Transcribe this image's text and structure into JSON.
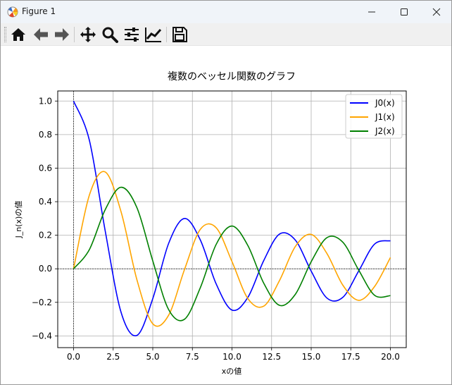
{
  "window": {
    "title": "Figure 1",
    "controls": {
      "minimize": "minimize",
      "maximize": "maximize",
      "close": "close"
    }
  },
  "toolbar": {
    "buttons": [
      {
        "name": "home",
        "icon": "home-icon",
        "tooltip": ""
      },
      {
        "name": "back",
        "icon": "arrow-left-icon",
        "tooltip": ""
      },
      {
        "name": "forward",
        "icon": "arrow-right-icon",
        "tooltip": ""
      },
      {
        "name": "pan",
        "icon": "move-icon",
        "tooltip": ""
      },
      {
        "name": "zoom",
        "icon": "magnifier-icon",
        "tooltip": ""
      },
      {
        "name": "configure-subplots",
        "icon": "sliders-icon",
        "tooltip": ""
      },
      {
        "name": "edit-axis",
        "icon": "line-chart-icon",
        "tooltip": ""
      },
      {
        "name": "save",
        "icon": "floppy-disk-icon",
        "tooltip": ""
      }
    ]
  },
  "colors": {
    "J0": "#0000ff",
    "J1": "#ffa500",
    "J2": "#008000",
    "grid": "#b0b0b0",
    "axis": "#000000"
  },
  "chart_data": {
    "type": "line",
    "title": "複数のベッセル関数のグラフ",
    "xlabel": "xの値",
    "ylabel": "J_n(x)の値",
    "xlim": [
      -1.0,
      21.0
    ],
    "ylim": [
      -0.47,
      1.06
    ],
    "xticks": [
      0.0,
      2.5,
      5.0,
      7.5,
      10.0,
      12.5,
      15.0,
      17.5,
      20.0
    ],
    "xtick_labels": [
      "0.0",
      "2.5",
      "5.0",
      "7.5",
      "10.0",
      "12.5",
      "15.0",
      "17.5",
      "20.0"
    ],
    "yticks": [
      -0.4,
      -0.2,
      0.0,
      0.2,
      0.4,
      0.6,
      0.8,
      1.0
    ],
    "ytick_labels": [
      "−0.4",
      "−0.2",
      "0.0",
      "0.2",
      "0.4",
      "0.6",
      "0.8",
      "1.0"
    ],
    "grid": true,
    "reference_lines": {
      "x": 0,
      "y": 0,
      "style": "dashed"
    },
    "legend": {
      "placement": "top-right",
      "entries": [
        "J0(x)",
        "J1(x)",
        "J2(x)"
      ]
    },
    "x": [
      0,
      1,
      2,
      3,
      4,
      5,
      6,
      7,
      8,
      9,
      10,
      11,
      12,
      13,
      14,
      15,
      16,
      17,
      18,
      19,
      20
    ],
    "series": [
      {
        "name": "J0(x)",
        "color": "#0000ff",
        "orders": 0,
        "values": [
          1.0,
          0.765,
          0.224,
          -0.26,
          -0.397,
          -0.178,
          0.151,
          0.3,
          0.172,
          -0.09,
          -0.246,
          -0.171,
          0.048,
          0.207,
          0.171,
          -0.014,
          -0.175,
          -0.17,
          -0.013,
          0.147,
          0.167
        ]
      },
      {
        "name": "J1(x)",
        "color": "#ffa500",
        "orders": 1,
        "values": [
          0.0,
          0.44,
          0.577,
          0.339,
          -0.066,
          -0.328,
          -0.277,
          -0.005,
          0.235,
          0.245,
          0.043,
          -0.177,
          -0.223,
          -0.07,
          0.133,
          0.205,
          0.09,
          -0.098,
          -0.188,
          -0.106,
          0.067
        ]
      },
      {
        "name": "J2(x)",
        "color": "#008000",
        "orders": 2,
        "values": [
          0.0,
          0.115,
          0.353,
          0.486,
          0.364,
          0.047,
          -0.243,
          -0.301,
          -0.113,
          0.145,
          0.255,
          0.139,
          -0.085,
          -0.218,
          -0.152,
          0.042,
          0.186,
          0.158,
          -0.008,
          -0.158,
          -0.16
        ]
      }
    ]
  }
}
